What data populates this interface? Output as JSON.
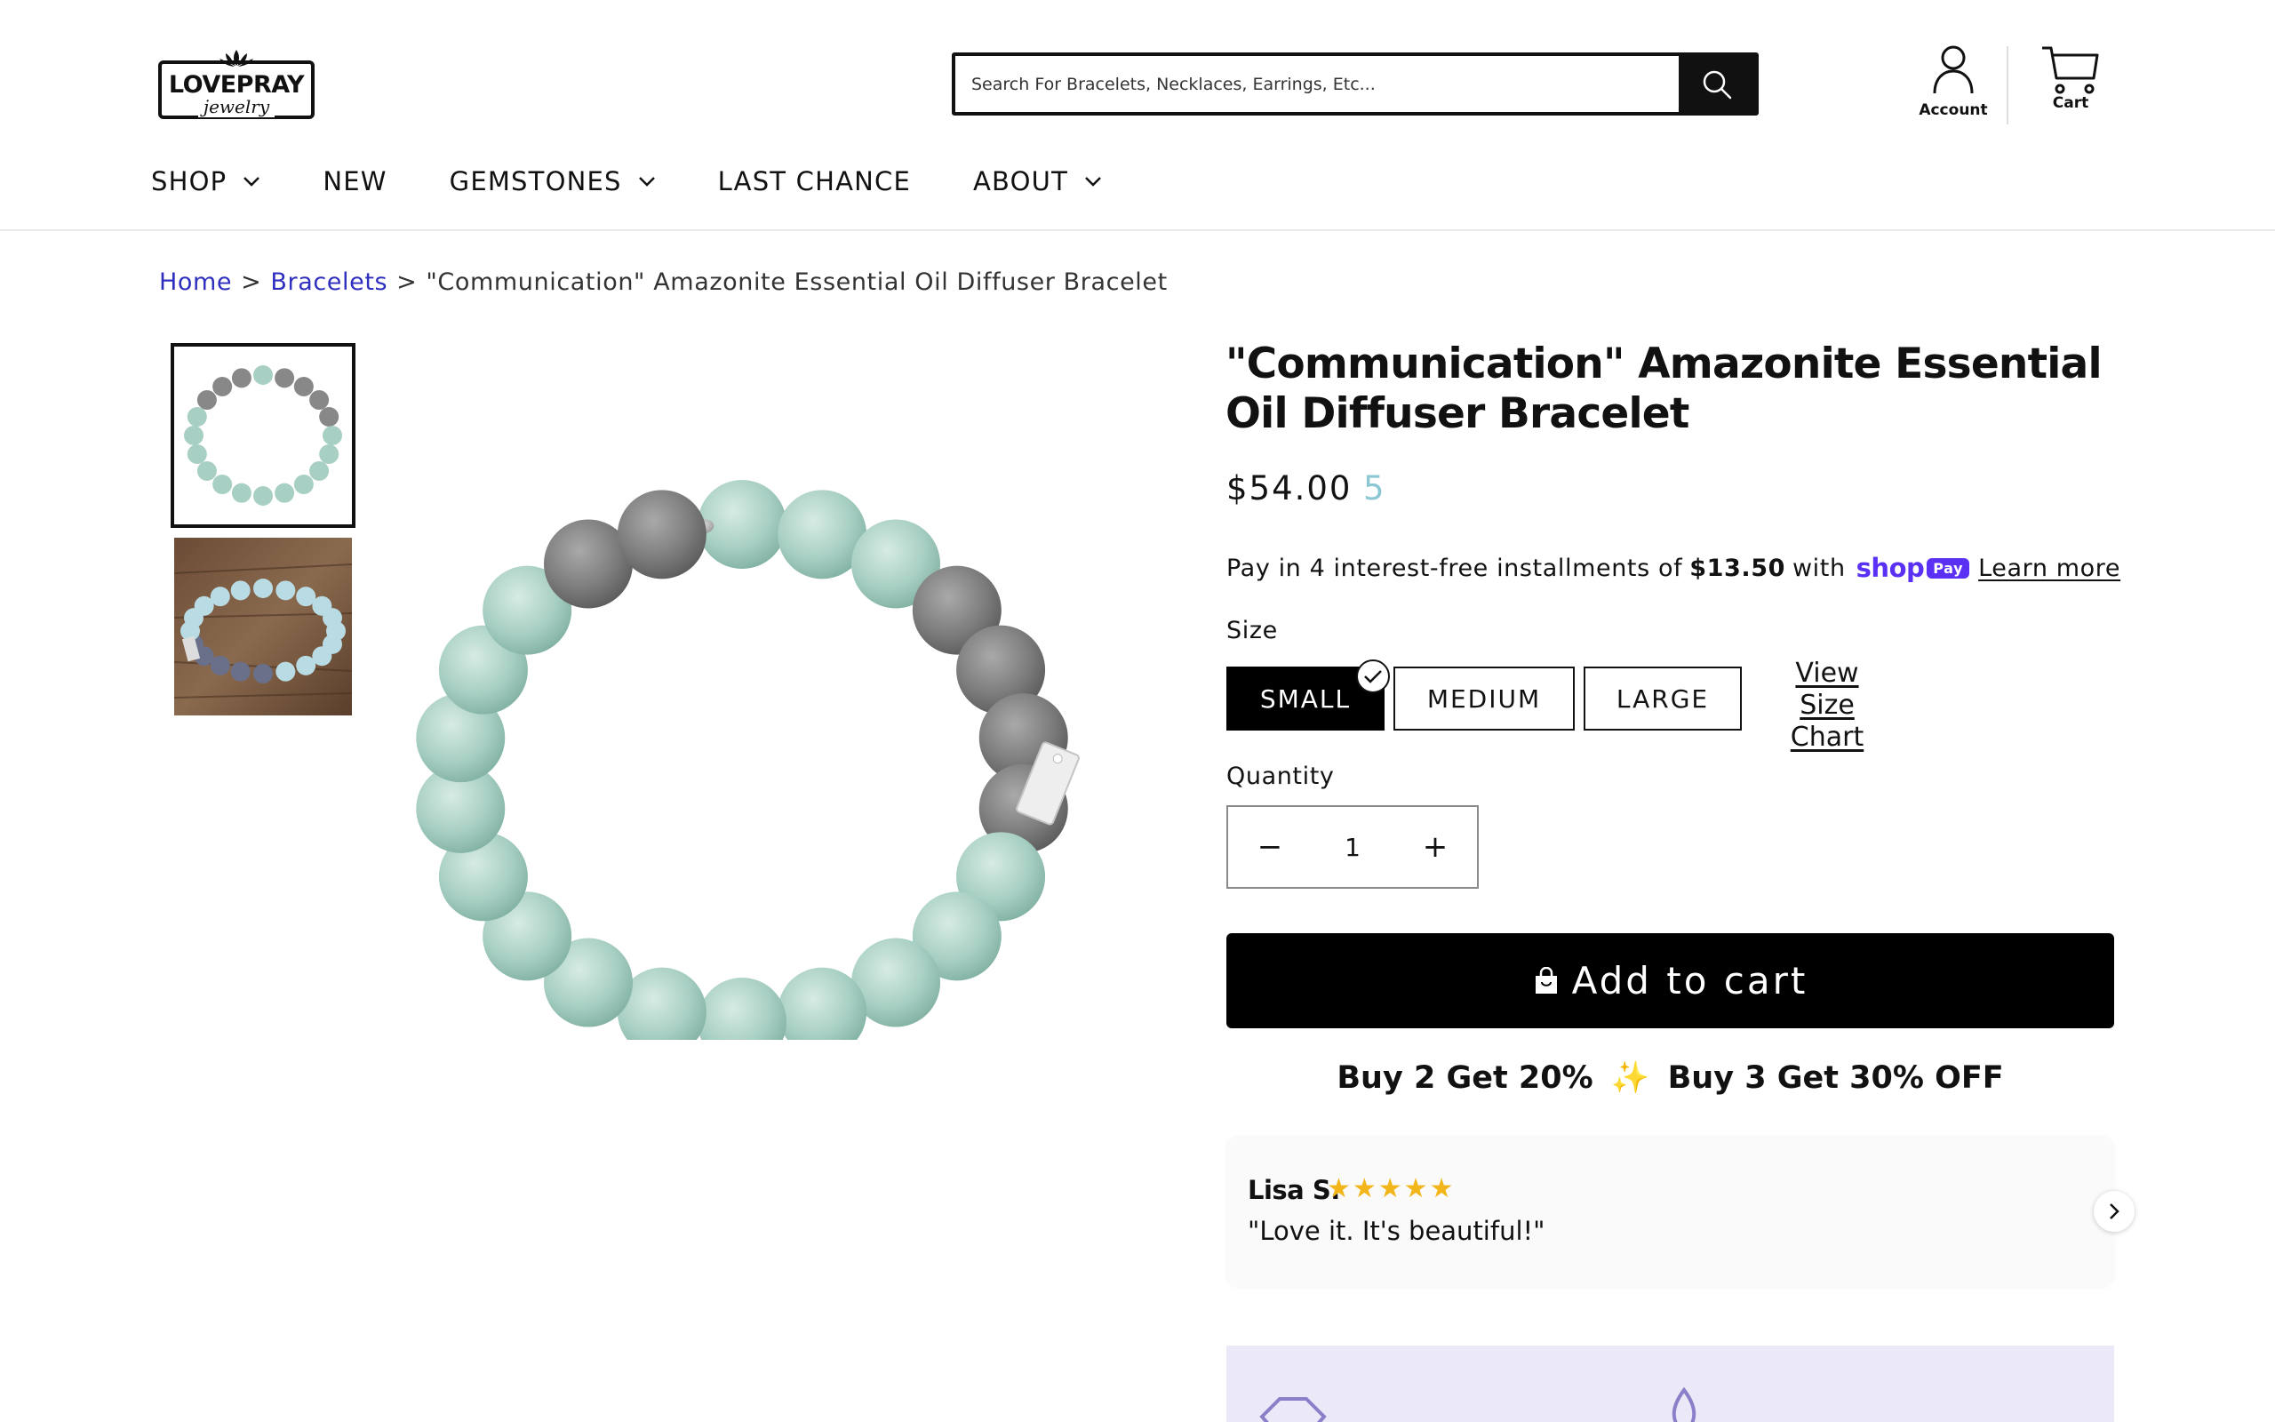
{
  "header": {
    "logo": {
      "title": "LOVEPRAY",
      "subtitle": "jewelry"
    },
    "search": {
      "placeholder": "Search For Bracelets, Necklaces, Earrings, Etc..."
    },
    "account_label": "Account",
    "cart_label": "Cart"
  },
  "nav": {
    "items": [
      {
        "label": "SHOP",
        "has_dropdown": true
      },
      {
        "label": "NEW",
        "has_dropdown": false
      },
      {
        "label": "GEMSTONES",
        "has_dropdown": true
      },
      {
        "label": "LAST CHANCE",
        "has_dropdown": false
      },
      {
        "label": "ABOUT",
        "has_dropdown": true
      }
    ]
  },
  "breadcrumb": {
    "home": "Home",
    "category": "Bracelets",
    "current": "\"Communication\" Amazonite Essential Oil Diffuser Bracelet",
    "separator": ">"
  },
  "product": {
    "title": "\"Communication\" Amazonite Essential Oil Diffuser Bracelet",
    "price": "$54.00",
    "price_badge": "5",
    "installments": {
      "prefix": "Pay in 4 interest-free installments of",
      "amount": "$13.50",
      "middle": "with",
      "shop_word": "shop",
      "pay_word": "Pay",
      "learn_more": "Learn more"
    },
    "size": {
      "label": "Size",
      "options": [
        "SMALL",
        "MEDIUM",
        "LARGE"
      ],
      "selected": "SMALL",
      "chart_link_line1": "View",
      "chart_link_line2": "Size Chart"
    },
    "quantity": {
      "label": "Quantity",
      "value": "1",
      "minus": "−",
      "plus": "+"
    },
    "add_to_cart": "Add to cart",
    "promo": {
      "part1": "Buy 2 Get 20%",
      "part2": "Buy 3 Get 30% OFF"
    },
    "review": {
      "name": "Lisa S.",
      "stars": "★★★★★",
      "rating": 5,
      "text": "\"Love it. It's beautiful!\""
    }
  },
  "colors": {
    "accent_link": "#2f2fbf",
    "shop_pay": "#5a31f4",
    "price_badge": "#8cc7d4",
    "stars": "#f2b61b",
    "banner_bg": "#ebe8f7"
  }
}
